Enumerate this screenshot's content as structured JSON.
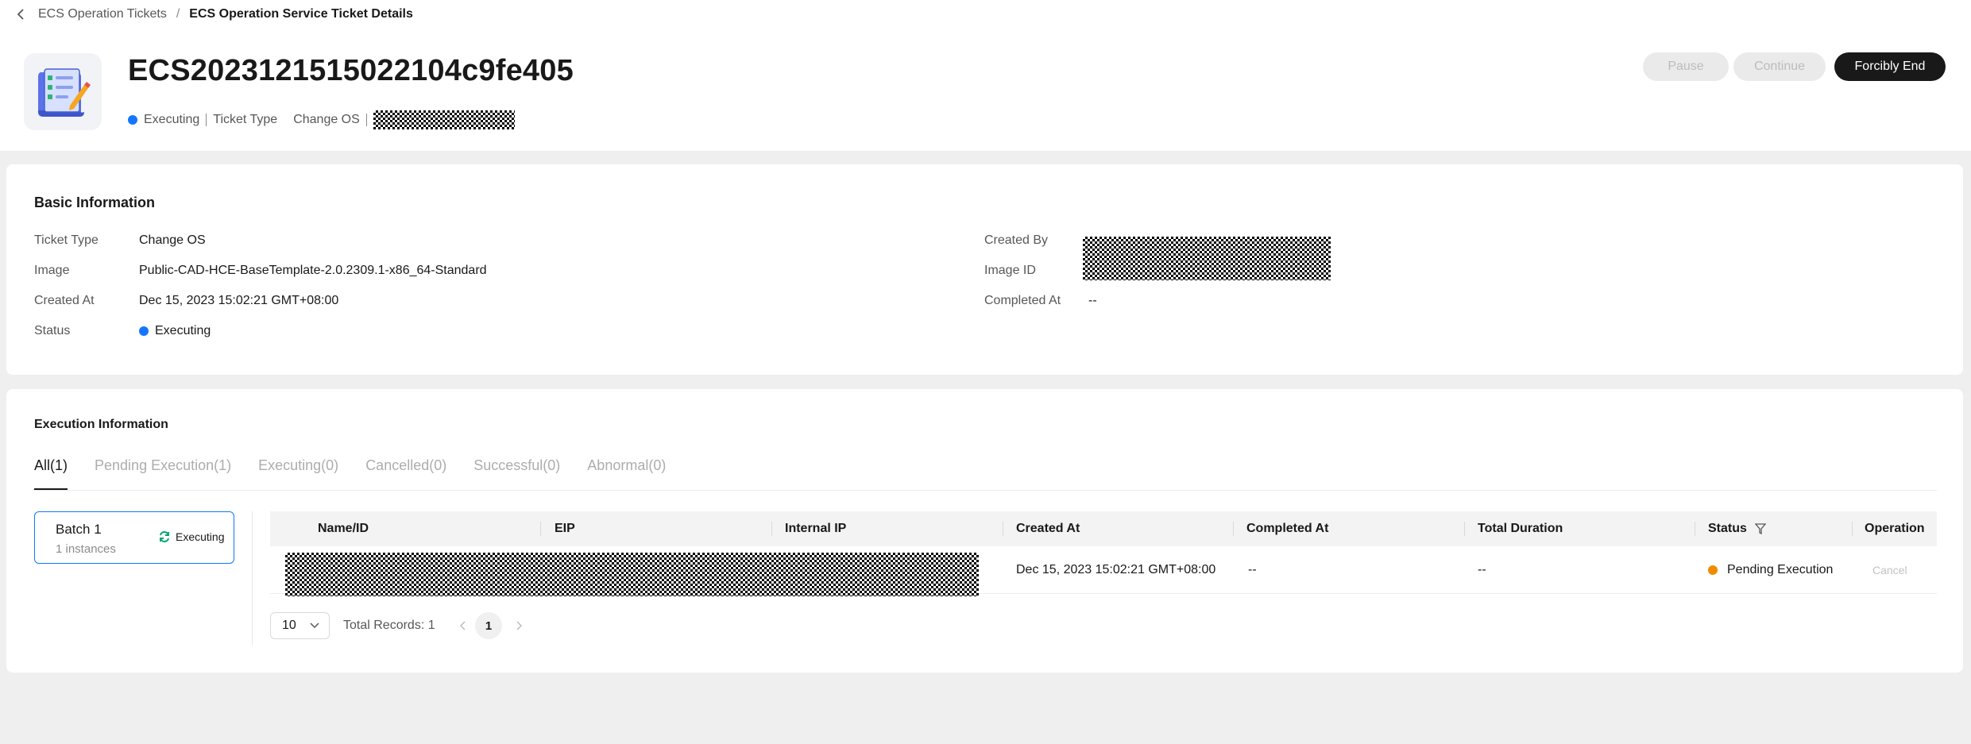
{
  "breadcrumb": {
    "parent": "ECS Operation Tickets",
    "separator": "/",
    "current": "ECS Operation Service Ticket Details"
  },
  "header": {
    "title": "ECS2023121515022104c9fe405",
    "status": "Executing",
    "ticket_type_label": "Ticket Type",
    "ticket_type_value": "Change OS"
  },
  "actions": {
    "pause": "Pause",
    "continue": "Continue",
    "forcibly_end": "Forcibly End"
  },
  "basic_info": {
    "title": "Basic Information",
    "ticket_type_label": "Ticket Type",
    "ticket_type_value": "Change OS",
    "image_label": "Image",
    "image_value": "Public-CAD-HCE-BaseTemplate-2.0.2309.1-x86_64-Standard",
    "created_at_label": "Created At",
    "created_at_value": "Dec 15, 2023 15:02:21 GMT+08:00",
    "status_label": "Status",
    "status_value": "Executing",
    "created_by_label": "Created By",
    "image_id_label": "Image ID",
    "completed_at_label": "Completed At",
    "completed_at_value": "--"
  },
  "execution": {
    "title": "Execution Information",
    "tabs": [
      {
        "label": "All(1)"
      },
      {
        "label": "Pending Execution(1)"
      },
      {
        "label": "Executing(0)"
      },
      {
        "label": "Cancelled(0)"
      },
      {
        "label": "Successful(0)"
      },
      {
        "label": "Abnormal(0)"
      }
    ],
    "batch": {
      "name": "Batch 1",
      "count": "1 instances",
      "status": "Executing"
    },
    "columns": [
      "Name/ID",
      "EIP",
      "Internal IP",
      "Created At",
      "Completed At",
      "Total Duration",
      "Status",
      "Operation"
    ],
    "row": {
      "created_at": "Dec 15, 2023 15:02:21 GMT+08:00",
      "completed_at": "--",
      "total_duration": "--",
      "status": "Pending Execution",
      "operation": "Cancel"
    },
    "pagination": {
      "page_size": "10",
      "total_records": "Total Records: 1",
      "current_page": "1"
    }
  },
  "colors": {
    "accent_blue": "#1476ff",
    "pending_orange": "#f08a00",
    "primary_button": "#191919",
    "executing_green": "#00a870"
  }
}
